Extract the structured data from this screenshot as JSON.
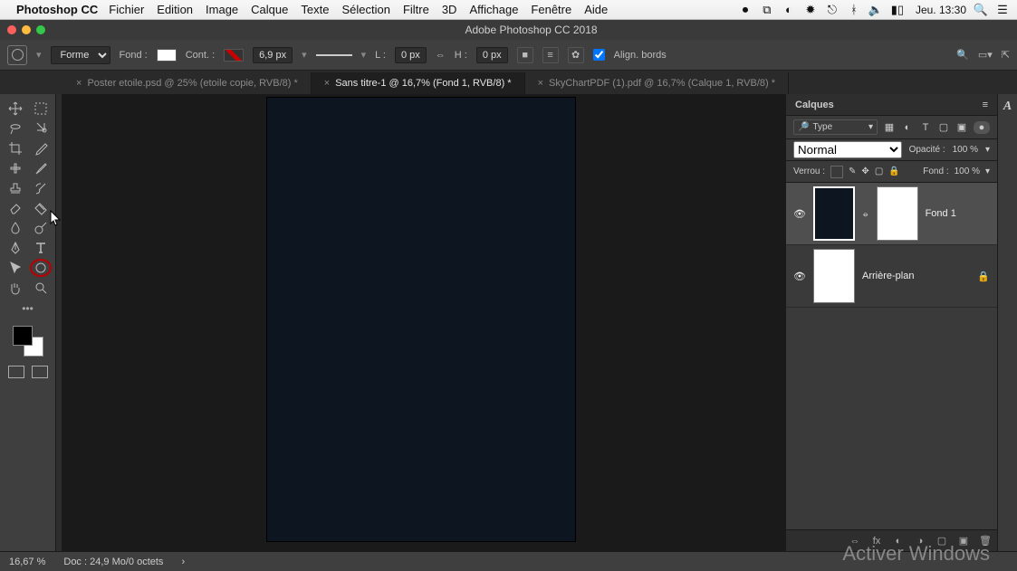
{
  "menubar": {
    "app_name": "Photoshop CC",
    "items": [
      "Fichier",
      "Edition",
      "Image",
      "Calque",
      "Texte",
      "Sélection",
      "Filtre",
      "3D",
      "Affichage",
      "Fenêtre",
      "Aide"
    ],
    "clock": "Jeu. 13:30"
  },
  "window": {
    "title": "Adobe Photoshop CC 2018"
  },
  "options": {
    "shape_label": "Forme",
    "fill_label": "Fond :",
    "stroke_label": "Cont. :",
    "stroke_width": "6,9 px",
    "w_label": "L :",
    "w_value": "0 px",
    "h_label": "H :",
    "h_value": "0 px",
    "align_label": "Align. bords"
  },
  "tabs": [
    {
      "title": "Poster etoile.psd @ 25% (etoile copie, RVB/8) *",
      "active": false
    },
    {
      "title": "Sans titre-1 @ 16,7% (Fond 1, RVB/8) *",
      "active": true
    },
    {
      "title": "SkyChartPDF (1).pdf @ 16,7% (Calque 1, RVB/8) *",
      "active": false
    }
  ],
  "layers_panel": {
    "header": "Calques",
    "type_label": "Type",
    "blend_mode": "Normal",
    "opacity_label": "Opacité :",
    "opacity_value": "100 %",
    "lock_label": "Verrou :",
    "fill_label": "Fond :",
    "fill_value": "100 %",
    "layers": [
      {
        "name": "Fond 1",
        "visible": true,
        "selected": true,
        "has_mask": true,
        "locked": false
      },
      {
        "name": "Arrière-plan",
        "visible": true,
        "selected": false,
        "has_mask": false,
        "locked": true
      }
    ]
  },
  "status": {
    "zoom": "16,67 %",
    "doc_info": "Doc : 24,9 Mo/0 octets"
  },
  "watermark": "Activer Windows"
}
